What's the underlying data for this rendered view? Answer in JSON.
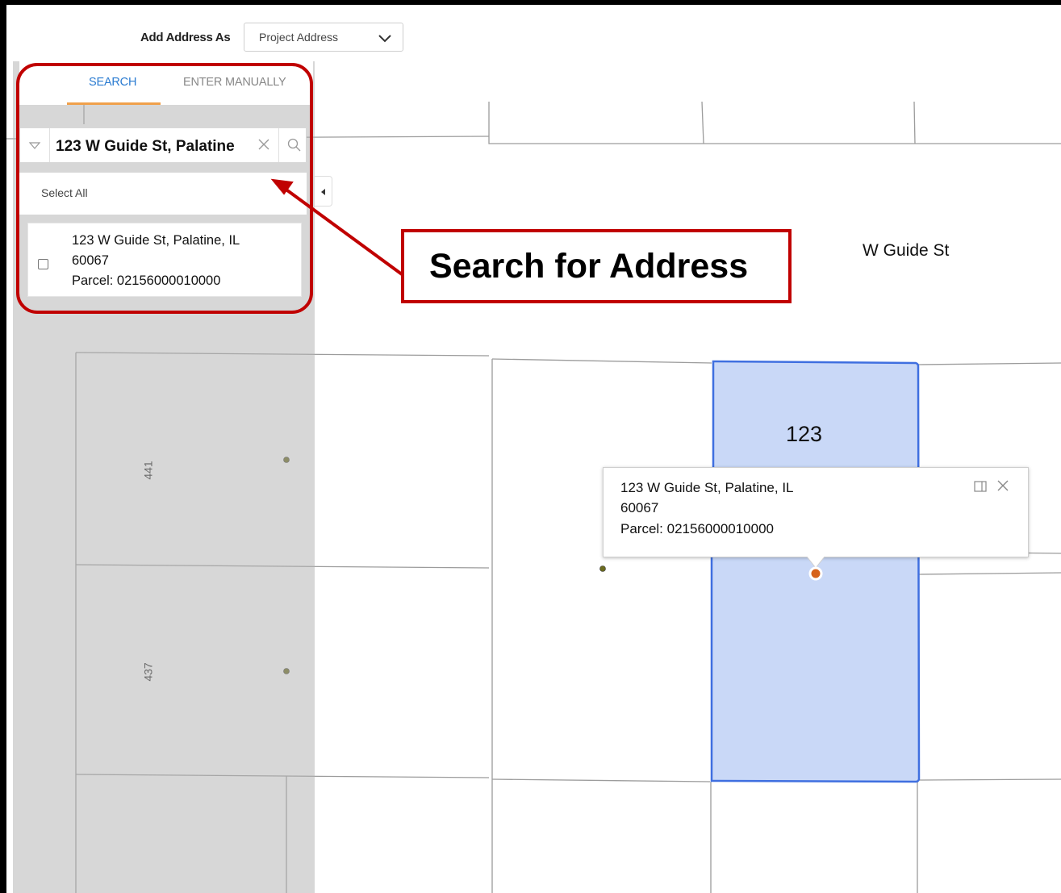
{
  "header": {
    "add_address_label": "Add Address As",
    "address_type": {
      "selected": "Project Address"
    }
  },
  "panel": {
    "tabs": [
      {
        "label": "SEARCH",
        "active": true
      },
      {
        "label": "ENTER MANUALLY",
        "active": false
      }
    ],
    "search": {
      "value": "123 W Guide St, Palatine"
    },
    "select_all_label": "Select All",
    "results": [
      {
        "line1": "123 W Guide St, Palatine, IL",
        "line2": "60067",
        "line3": "Parcel: 02156000010000",
        "checked": false
      }
    ]
  },
  "annotation": {
    "label": "Search for Address",
    "color": "#c00000"
  },
  "map": {
    "street_label": "W Guide St",
    "selected_parcel_number": "123",
    "lot_numbers": [
      "441",
      "437"
    ],
    "highlight_color": "#c9d8f7",
    "highlight_border": "#3f6fe0",
    "popup": {
      "line1": "123 W Guide St, Palatine, IL",
      "line2": "60067",
      "line3": "Parcel: 02156000010000"
    }
  },
  "icons": [
    "chevron-down-icon",
    "triangle-down-icon",
    "close-icon",
    "search-icon",
    "collapse-left-icon",
    "dock-icon",
    "location-marker-icon"
  ]
}
